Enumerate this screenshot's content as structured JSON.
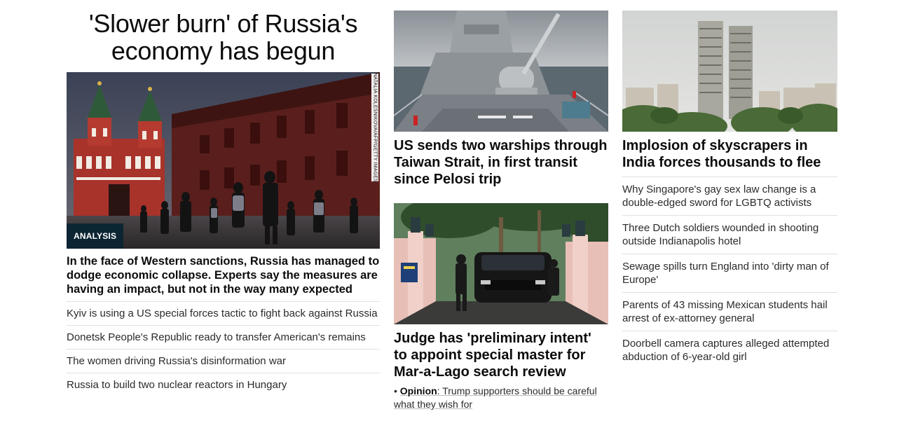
{
  "left": {
    "headline": "'Slower burn' of Russia's economy has begun",
    "badge": "ANALYSIS",
    "photo_credit": "NATALIA KOLESNIKOVA/AFP/GETTY IMAGES",
    "dek": "In the face of Western sanctions, Russia has managed to dodge economic collapse. Experts say the measures are having an impact, but not in the way many expected",
    "links": [
      "Kyiv is using a US special forces tactic to fight back against Russia",
      "Donetsk People's Republic ready to transfer American's remains",
      "The women driving Russia's disinformation war",
      "Russia to build two nuclear reactors in Hungary"
    ]
  },
  "middle": {
    "card1": {
      "headline": "US sends two warships through Taiwan Strait, in first transit since Pelosi trip",
      "image_icon": "warship-image"
    },
    "card2": {
      "headline": "Judge has 'preliminary intent' to appoint special master for Mar-a-Lago search review",
      "image_icon": "mar-a-lago-gate-image",
      "opinion_label": "Opinion",
      "opinion_text": ": Trump supporters should be careful what they wish for",
      "bullet": "•"
    }
  },
  "right": {
    "headline": "Implosion of skyscrapers in India forces thousands to flee",
    "image_icon": "twin-towers-image",
    "links": [
      "Why Singapore's gay sex law change is a double-edged sword for LGBTQ activists",
      "Three Dutch soldiers wounded in shooting outside Indianapolis hotel",
      "Sewage spills turn England into 'dirty man of Europe'",
      "Parents of 43 missing Mexican students hail arrest of ex-attorney general",
      "Doorbell camera captures alleged attempted abduction of 6-year-old girl"
    ]
  },
  "colors": {
    "badge_bg": "#0c2533",
    "text": "#0c0c0c",
    "divider": "#e0e0e0"
  }
}
